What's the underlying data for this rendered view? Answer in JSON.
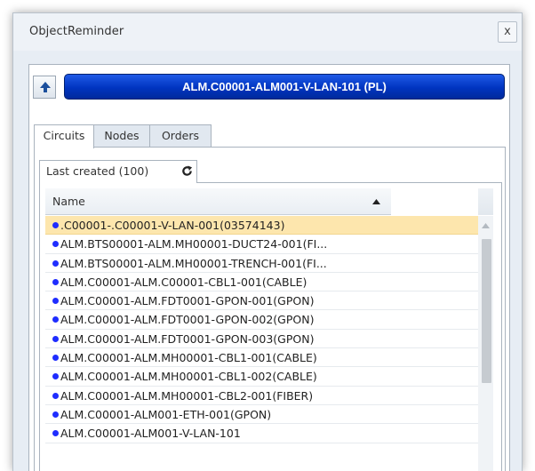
{
  "window": {
    "title": "ObjectReminder",
    "close_label": "x"
  },
  "toolbar": {
    "up_icon": "arrow-up-icon",
    "path": "ALM.C00001-ALM001-V-LAN-101 (PL)"
  },
  "tabs": [
    {
      "label": "Circuits",
      "active": true
    },
    {
      "label": "Nodes",
      "active": false
    },
    {
      "label": "Orders",
      "active": false
    }
  ],
  "subtab": {
    "label": "Last created (100)",
    "icon": "refresh-icon"
  },
  "grid": {
    "column_header": "Name",
    "sort": "ascending",
    "rows": [
      ".C00001-.C00001-V-LAN-001(03574143)",
      "ALM.BTS00001-ALM.MH00001-DUCT24-001(FI...",
      "ALM.BTS00001-ALM.MH00001-TRENCH-001(FI...",
      "ALM.C00001-ALM.C00001-CBL1-001(CABLE)",
      "ALM.C00001-ALM.FDT0001-GPON-001(GPON)",
      "ALM.C00001-ALM.FDT0001-GPON-002(GPON)",
      "ALM.C00001-ALM.FDT0001-GPON-003(GPON)",
      "ALM.C00001-ALM.MH00001-CBL1-001(CABLE)",
      "ALM.C00001-ALM.MH00001-CBL1-002(CABLE)",
      "ALM.C00001-ALM.MH00001-CBL2-001(FIBER)",
      "ALM.C00001-ALM001-ETH-001(GPON)",
      "ALM.C00001-ALM001-V-LAN-101"
    ],
    "selected_index": 0
  },
  "colors": {
    "path_bar": "#0034c0",
    "selected_row": "#fde6ad",
    "status_dot": "#1f2dff"
  }
}
